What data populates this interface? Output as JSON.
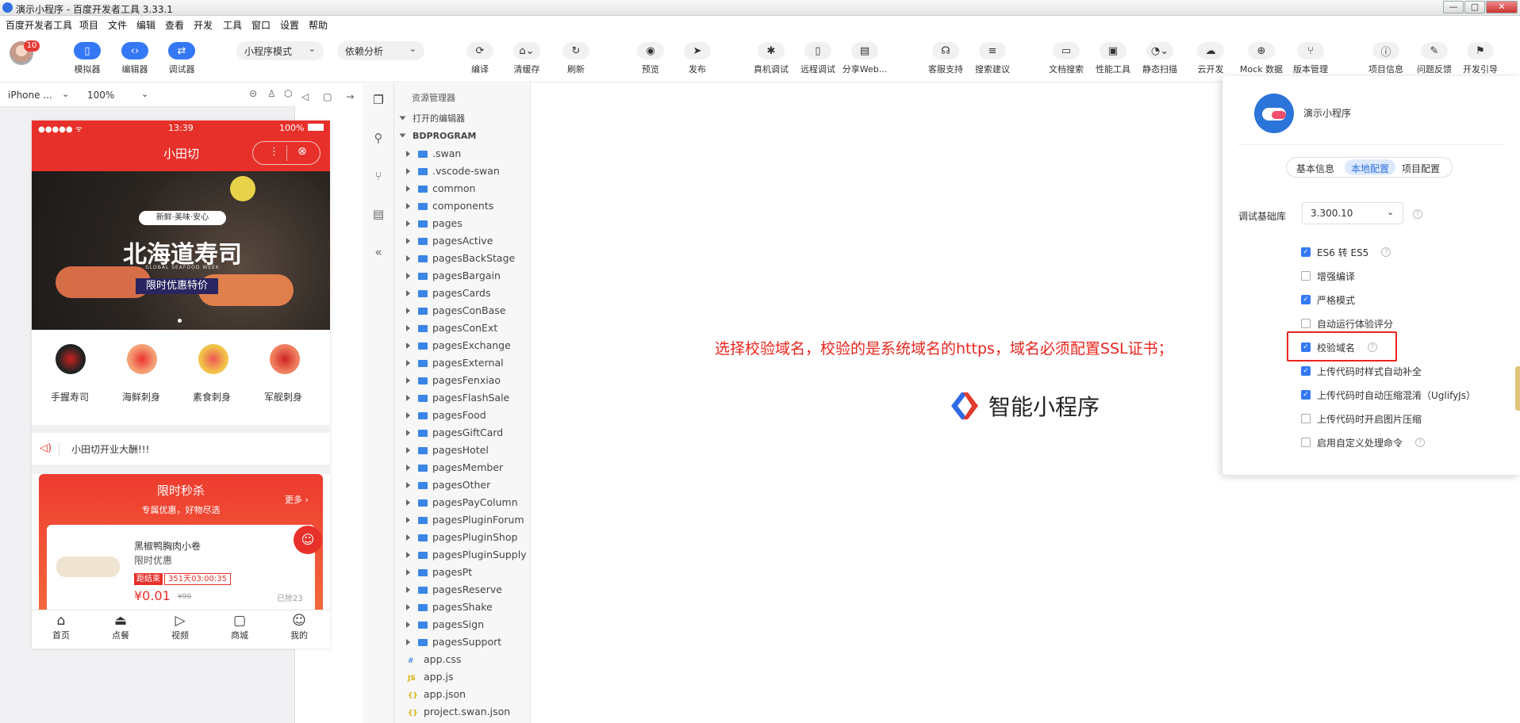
{
  "window": {
    "title": "演示小程序 - 百度开发者工具 3.33.1",
    "controls": [
      "—",
      "▢",
      "✕"
    ]
  },
  "menubar": [
    "百度开发者工具",
    "项目",
    "文件",
    "编辑",
    "查看",
    "开发",
    "工具",
    "窗口",
    "设置",
    "帮助"
  ],
  "toolbar": {
    "avatar_badge": "10",
    "mode_buttons": [
      {
        "label": "模拟器",
        "icon": "phone"
      },
      {
        "label": "编辑器",
        "icon": "code"
      },
      {
        "label": "调试器",
        "icon": "sliders"
      }
    ],
    "mode_select": "小程序模式",
    "dep_select": "依赖分析",
    "actions": [
      {
        "label": "编译"
      },
      {
        "label": "清缓存"
      },
      {
        "label": "刷新"
      },
      {
        "label": "预览"
      },
      {
        "label": "发布"
      },
      {
        "label": "真机调试"
      },
      {
        "label": "远程调试"
      },
      {
        "label": "分享Web..."
      },
      {
        "label": "客服支持"
      },
      {
        "label": "搜索建议"
      },
      {
        "label": "文档搜索"
      },
      {
        "label": "性能工具"
      },
      {
        "label": "静态扫描"
      },
      {
        "label": "云开发"
      },
      {
        "label": "Mock 数据"
      },
      {
        "label": "版本管理"
      },
      {
        "label": "项目信息"
      },
      {
        "label": "问题反馈"
      },
      {
        "label": "开发引导"
      }
    ]
  },
  "simulator": {
    "device": "iPhone ...",
    "zoom": "100%",
    "status_time": "13:39",
    "status_battery": "100%",
    "nav_title": "小田切",
    "banner": {
      "badge": "新鲜·美味·安心",
      "title": "北海道寿司",
      "subtitle": "GLOBAL SEAFOOD WEEK",
      "tag": "限时优惠特价"
    },
    "categories": [
      "手握寿司",
      "海鲜刺身",
      "素食刺身",
      "军舰刺身"
    ],
    "notice": "小田切开业大酬!!!",
    "flash": {
      "title": "限时秒杀",
      "subtitle": "专属优惠，好物尽选",
      "more": "更多 ›"
    },
    "product": {
      "name": "黑椒鸭胸肉小卷",
      "promo": "限时优惠",
      "countdown_label": "距结束",
      "countdown": "351天03:00:35",
      "price": "¥0.01",
      "original_price": "¥99",
      "sold": "已抢23"
    },
    "tabbar": [
      "首页",
      "点餐",
      "视频",
      "商城",
      "我的"
    ]
  },
  "explorer": {
    "title": "资源管理器",
    "open_editors": "打开的编辑器",
    "root": "BDPROGRAM",
    "folders": [
      ".swan",
      ".vscode-swan",
      "common",
      "components",
      "pages",
      "pagesActive",
      "pagesBackStage",
      "pagesBargain",
      "pagesCards",
      "pagesConBase",
      "pagesConExt",
      "pagesExchange",
      "pagesExternal",
      "pagesFenxiao",
      "pagesFlashSale",
      "pagesFood",
      "pagesGiftCard",
      "pagesHotel",
      "pagesMember",
      "pagesOther",
      "pagesPayColumn",
      "pagesPluginForum",
      "pagesPluginShop",
      "pagesPluginSupply",
      "pagesPt",
      "pagesReserve",
      "pagesShake",
      "pagesSign",
      "pagesSupport"
    ],
    "files": [
      {
        "badge": "#",
        "name": "app.css",
        "color": "#4a8fe0"
      },
      {
        "badge": "JS",
        "name": "app.js",
        "color": "#d4b106"
      },
      {
        "badge": "{}",
        "name": "app.json",
        "color": "#d4b106"
      },
      {
        "badge": "{}",
        "name": "project.swan.json",
        "color": "#d4b106"
      }
    ]
  },
  "editor": {
    "annotation": "选择校验域名，校验的是系统域名的https，域名必须配置SSL证书；",
    "annotation_color": "#e8261e",
    "brand": "智能小程序"
  },
  "config_panel": {
    "app_name": "演示小程序",
    "tabs": [
      "基本信息",
      "本地配置",
      "项目配置"
    ],
    "active_tab": "本地配置",
    "base_lib_label": "调试基础库",
    "base_lib_value": "3.300.10",
    "options": [
      {
        "label": "ES6 转 ES5",
        "checked": true,
        "help": true
      },
      {
        "label": "增强编译",
        "checked": false,
        "help": false
      },
      {
        "label": "严格模式",
        "checked": true,
        "help": false
      },
      {
        "label": "自动运行体验评分",
        "checked": false,
        "help": false
      },
      {
        "label": "校验域名",
        "checked": true,
        "help": true,
        "highlighted": true
      },
      {
        "label": "上传代码时样式自动补全",
        "checked": true,
        "help": false
      },
      {
        "label": "上传代码时自动压缩混淆（UglifyJs）",
        "checked": true,
        "help": false
      },
      {
        "label": "上传代码时开启图片压缩",
        "checked": false,
        "help": false
      },
      {
        "label": "启用自定义处理命令",
        "checked": false,
        "help": true
      }
    ],
    "highlight_color": "#e8261e"
  }
}
